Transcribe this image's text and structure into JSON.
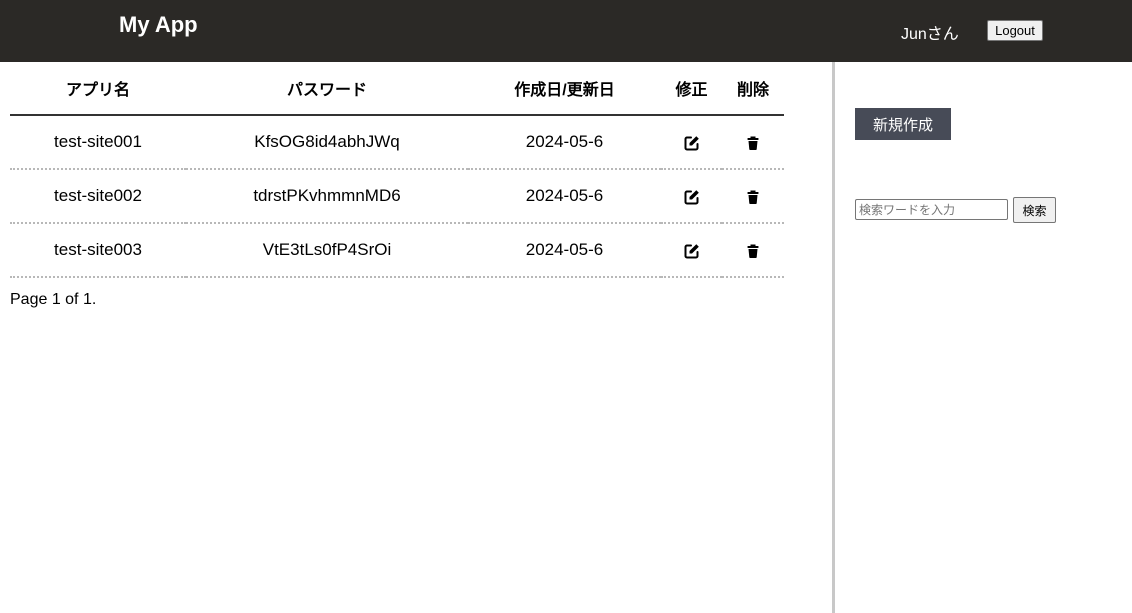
{
  "header": {
    "title": "My App",
    "user": "Junさん",
    "logout_label": "Logout"
  },
  "table": {
    "columns": [
      "アプリ名",
      "パスワード",
      "作成日/更新日",
      "修正",
      "削除"
    ],
    "rows": [
      {
        "app": "test-site001",
        "password": "KfsOG8id4abhJWq",
        "date": "2024-05-6"
      },
      {
        "app": "test-site002",
        "password": "tdrstPKvhmmnMD6",
        "date": "2024-05-6"
      },
      {
        "app": "test-site003",
        "password": "VtE3tLs0fP4SrOi",
        "date": "2024-05-6"
      }
    ],
    "edit_icon": "edit-icon",
    "delete_icon": "trash-icon"
  },
  "pagination": {
    "text": "Page 1 of 1."
  },
  "sidebar": {
    "new_label": "新規作成",
    "search_placeholder": "検索ワードを入力",
    "search_value": "",
    "search_label": "検索"
  }
}
